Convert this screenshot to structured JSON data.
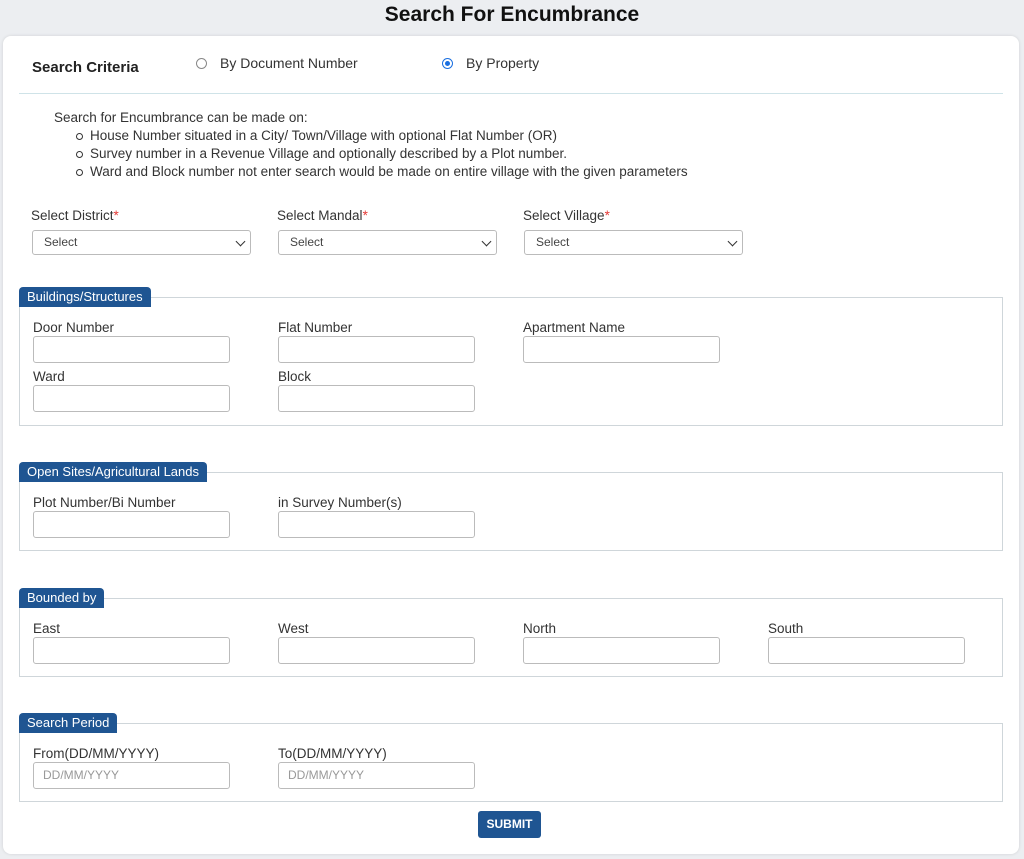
{
  "page": {
    "title": "Search For Encumbrance"
  },
  "criteria": {
    "label": "Search Criteria",
    "options": [
      {
        "label": "By Document Number",
        "selected": false
      },
      {
        "label": "By Property",
        "selected": true
      }
    ]
  },
  "info": {
    "intro": "Search for Encumbrance can be made on:",
    "items": [
      "House Number situated in a City/ Town/Village with optional Flat Number (OR)",
      "Survey number in a Revenue Village and optionally described by a Plot number.",
      "Ward and Block number not enter search would be made on entire village with the given parameters"
    ]
  },
  "location": {
    "district": {
      "label": "Select District",
      "value": "Select"
    },
    "mandal": {
      "label": "Select Mandal",
      "value": "Select"
    },
    "village": {
      "label": "Select Village",
      "value": "Select"
    },
    "required_mark": "*"
  },
  "buildings": {
    "legend": "Buildings/Structures",
    "door_number": {
      "label": "Door Number",
      "value": ""
    },
    "flat_number": {
      "label": "Flat Number",
      "value": ""
    },
    "apartment_name": {
      "label": "Apartment Name",
      "value": ""
    },
    "ward": {
      "label": "Ward",
      "value": ""
    },
    "block": {
      "label": "Block",
      "value": ""
    }
  },
  "open_sites": {
    "legend": "Open Sites/Agricultural Lands",
    "plot_number": {
      "label": "Plot Number/Bi Number",
      "value": ""
    },
    "survey_number": {
      "label": "in Survey Number(s)",
      "value": ""
    }
  },
  "bounded_by": {
    "legend": "Bounded by",
    "east": {
      "label": "East",
      "value": ""
    },
    "west": {
      "label": "West",
      "value": ""
    },
    "north": {
      "label": "North",
      "value": ""
    },
    "south": {
      "label": "South",
      "value": ""
    }
  },
  "search_period": {
    "legend": "Search Period",
    "from": {
      "label": "From(DD/MM/YYYY)",
      "placeholder": "DD/MM/YYYY",
      "value": ""
    },
    "to": {
      "label": "To(DD/MM/YYYY)",
      "placeholder": "DD/MM/YYYY",
      "value": ""
    }
  },
  "actions": {
    "submit_label": "SUBMIT"
  },
  "colors": {
    "legend_bg": "#1f5592",
    "radio_selected": "#1a6fe0",
    "required": "#e53935"
  }
}
